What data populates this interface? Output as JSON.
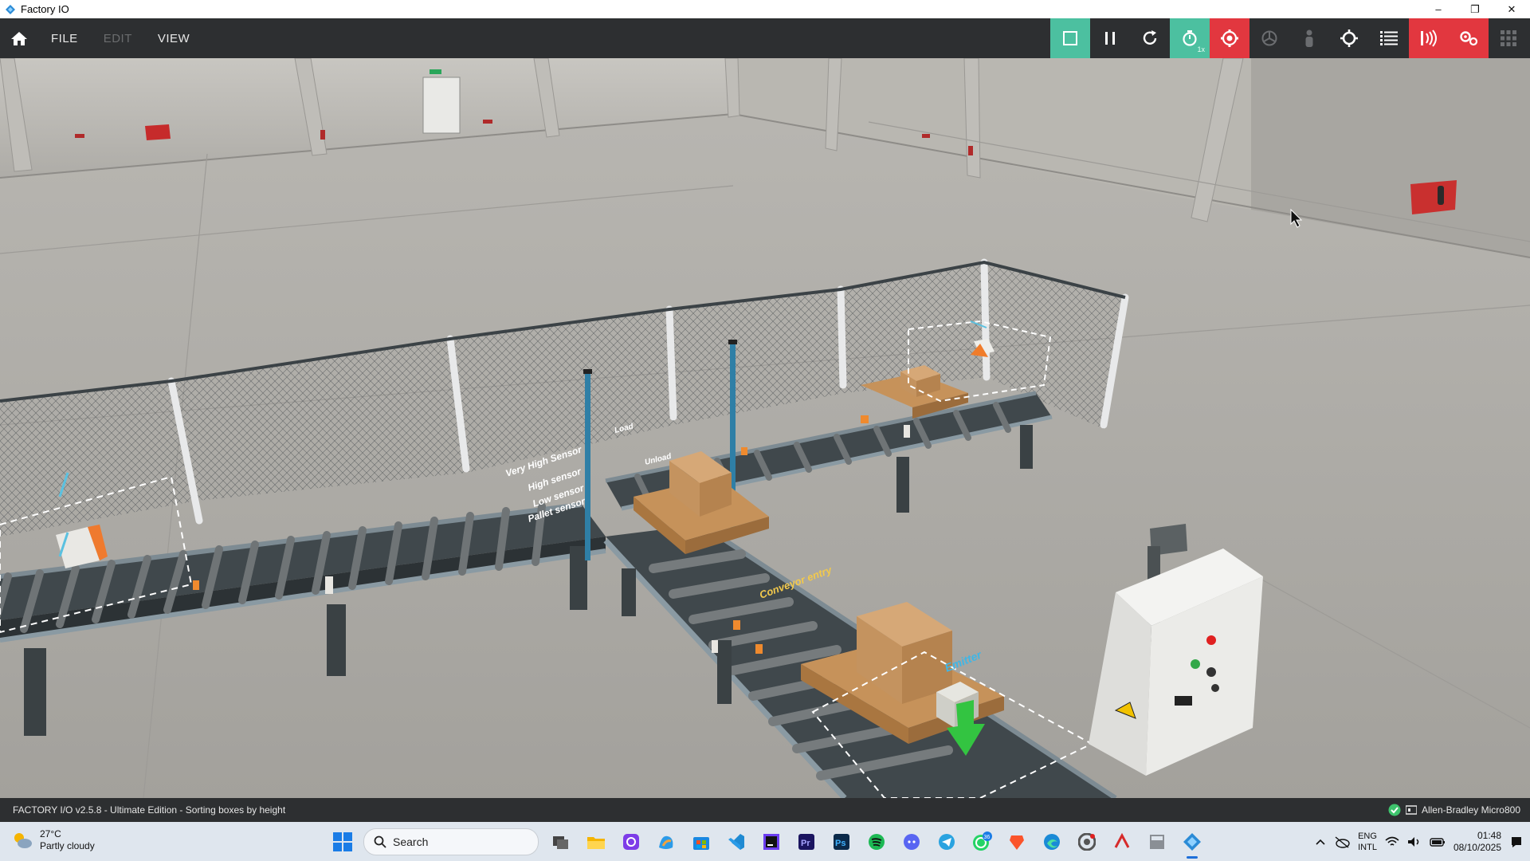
{
  "window": {
    "title": "Factory IO",
    "controls": [
      "minimize",
      "maximize",
      "close"
    ]
  },
  "menubar": {
    "items": [
      {
        "label": "FILE",
        "enabled": true
      },
      {
        "label": "EDIT",
        "enabled": false
      },
      {
        "label": "VIEW",
        "enabled": true
      }
    ],
    "toolbar": [
      {
        "icon": "edit-mode-icon",
        "state": "active",
        "color": "#4cc0a0"
      },
      {
        "icon": "pause-icon",
        "state": "normal"
      },
      {
        "icon": "reset-icon",
        "state": "normal"
      },
      {
        "icon": "timer-icon",
        "state": "active",
        "color": "#4cc0a0",
        "badge": "1x"
      },
      {
        "icon": "camera-orbit-icon",
        "state": "active",
        "color": "#e2373f"
      },
      {
        "icon": "camera-fly-icon",
        "state": "disabled"
      },
      {
        "icon": "first-person-icon",
        "state": "disabled"
      },
      {
        "icon": "crosshair-icon",
        "state": "normal"
      },
      {
        "icon": "list-icon",
        "state": "normal"
      },
      {
        "icon": "sensors-icon",
        "state": "active",
        "color": "#e2373f"
      },
      {
        "icon": "drivers-icon",
        "state": "active",
        "color": "#e2373f"
      },
      {
        "icon": "grid-icon",
        "state": "disabled"
      }
    ]
  },
  "scene": {
    "labels": {
      "very_high_sensor": "Very High Sensor",
      "high_sensor": "High sensor",
      "low_sensor": "Low sensor",
      "pallet_sensor": "Pallet sensor",
      "load": "Load",
      "unload": "Unload",
      "conveyor_entry": "Conveyor entry",
      "emitter": "Emitter"
    }
  },
  "statusbar": {
    "left": "FACTORY I/O v2.5.8 - Ultimate Edition - Sorting  boxes by height",
    "driver": "Allen-Bradley Micro800",
    "status_color": "#3ec46d"
  },
  "taskbar": {
    "weather": {
      "temp": "27°C",
      "condition": "Partly cloudy"
    },
    "search_placeholder": "Search",
    "apps": [
      {
        "icon": "task-view-icon"
      },
      {
        "icon": "file-explorer-icon"
      },
      {
        "icon": "camera-app-icon"
      },
      {
        "icon": "copilot-icon"
      },
      {
        "icon": "store-icon"
      },
      {
        "icon": "vscode-icon"
      },
      {
        "icon": "intellij-icon"
      },
      {
        "icon": "premiere-icon"
      },
      {
        "icon": "photoshop-icon"
      },
      {
        "icon": "spotify-icon"
      },
      {
        "icon": "discord-icon"
      },
      {
        "icon": "telegram-icon"
      },
      {
        "icon": "whatsapp-icon",
        "badge": "36"
      },
      {
        "icon": "brave-icon"
      },
      {
        "icon": "edge-icon"
      },
      {
        "icon": "chrome-dev-icon"
      },
      {
        "icon": "pdf-reader-icon"
      },
      {
        "icon": "calculator-icon"
      },
      {
        "icon": "factory-io-icon",
        "active": true
      }
    ],
    "tray": {
      "lang_top": "ENG",
      "lang_bottom": "INTL",
      "time": "01:48",
      "date": "08/10/2025"
    }
  }
}
